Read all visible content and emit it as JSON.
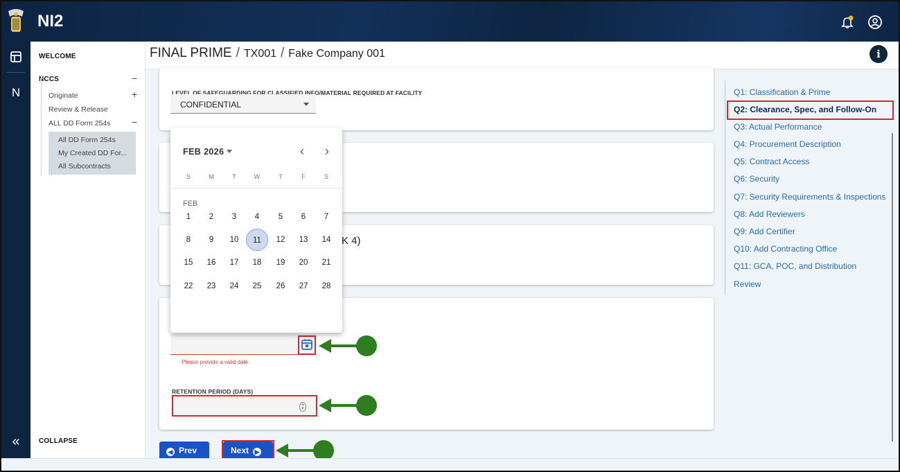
{
  "app": {
    "title": "NI2"
  },
  "header": {
    "crumb1": "FINAL PRIME",
    "crumb2": "TX001",
    "crumb3": "Fake Company 001",
    "info_icon": "i"
  },
  "rail": {
    "home_icon": "layout-icon",
    "n_label": "N",
    "collapse_icon": "«"
  },
  "sidebar": {
    "welcome": "WELCOME",
    "nccs": "NCCS",
    "nccs_toggle": "−",
    "originate": "Originate",
    "originate_toggle": "+",
    "review_release": "Review & Release",
    "all_dd": "ALL DD Form 254s",
    "all_dd_toggle": "−",
    "sub_items": [
      "All DD Form 254s",
      "My Created DD For...",
      "All Subcontracts"
    ],
    "collapse": "COLLAPSE"
  },
  "form": {
    "safeguarding_label": "LEVEL OF SAFEGUARDING FOR CLASSIFIED INFO/MATERIAL REQUIRED AT FACILITY",
    "safeguarding_value": "CONFIDENTIAL",
    "partial_text": "K 4)",
    "date_error": "Please provide a valid date",
    "retention_label": "RETENTION PERIOD (DAYS)",
    "retention_value": "",
    "spinner": "⌃⌄"
  },
  "calendar": {
    "month_label": "FEB 2026",
    "prev": "‹",
    "next": "›",
    "dow": [
      "S",
      "M",
      "T",
      "W",
      "T",
      "F",
      "S"
    ],
    "section_label": "FEB",
    "weeks": [
      [
        "1",
        "2",
        "3",
        "4",
        "5",
        "6",
        "7"
      ],
      [
        "8",
        "9",
        "10",
        "11",
        "12",
        "13",
        "14"
      ],
      [
        "15",
        "16",
        "17",
        "18",
        "19",
        "20",
        "21"
      ],
      [
        "22",
        "23",
        "24",
        "25",
        "26",
        "27",
        "28"
      ]
    ],
    "today": "11"
  },
  "buttons": {
    "prev": "Prev",
    "next": "Next",
    "prev_icon": "◀",
    "next_icon": "▶"
  },
  "rightnav": {
    "items": [
      "Q1: Classification & Prime",
      "Q2: Clearance, Spec, and Follow-On",
      "Q3: Actual Performance",
      "Q4: Procurement Description",
      "Q5: Contract Access",
      "Q6: Security",
      "Q7: Security Requirements & Inspections",
      "Q8: Add Reviewers",
      "Q9: Add Certifier",
      "Q10: Add Contracting Office",
      "Q11: GCA, POC, and Distribution",
      "Review"
    ],
    "active_index": 1
  },
  "colors": {
    "navy": "#0e2542",
    "button_blue": "#1a53c9",
    "highlight_red": "#d7262e",
    "arrow_green": "#2e7d1f",
    "link_blue": "#2b6cb3"
  }
}
